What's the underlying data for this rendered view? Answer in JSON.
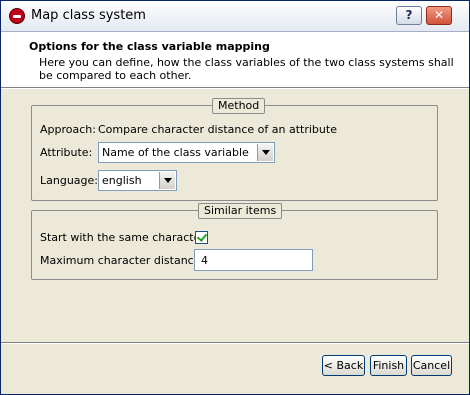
{
  "window": {
    "title": "Map class system",
    "help_label": "?",
    "close_label": "✕"
  },
  "header": {
    "title": "Options for the class variable mapping",
    "description": "Here you can define, how the class variables of the two class systems shall be compared to each other."
  },
  "method": {
    "legend": "Method",
    "approach_label": "Approach:",
    "approach_value": "Compare character distance of an attribute",
    "attribute_label": "Attribute:",
    "attribute_value": "Name of the class variable",
    "language_label": "Language:",
    "language_value": "english"
  },
  "similar": {
    "legend": "Similar items",
    "start_same_label": "Start with the same character:",
    "start_same_checked": true,
    "max_distance_label": "Maximum character distance:",
    "max_distance_value": "4"
  },
  "buttons": {
    "back": "< Back",
    "finish": "Finish",
    "cancel": "Cancel"
  }
}
